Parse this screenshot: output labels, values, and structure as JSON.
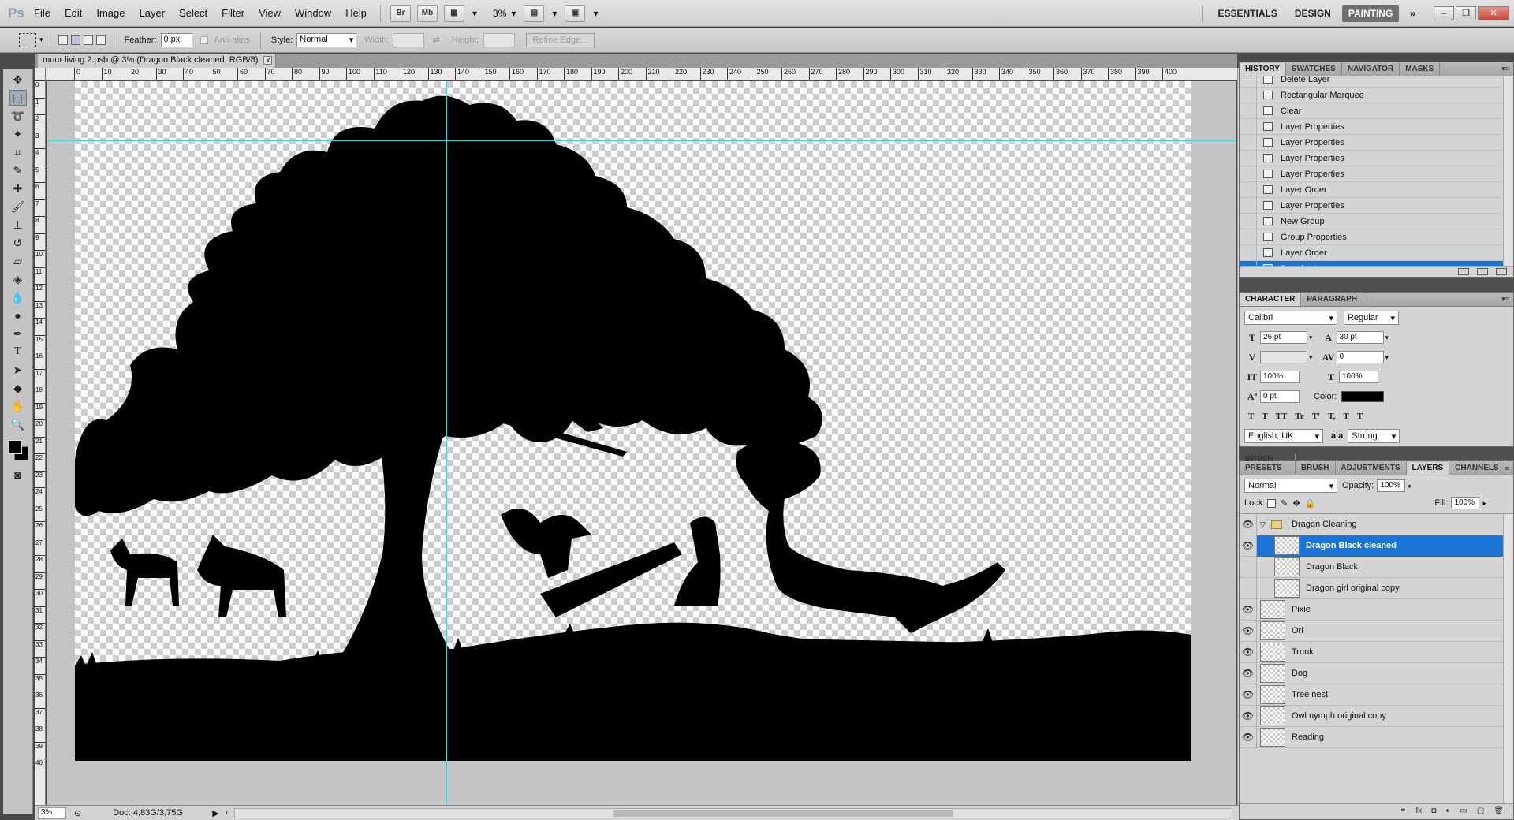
{
  "app": {
    "logo": "Ps"
  },
  "menu": [
    "File",
    "Edit",
    "Image",
    "Layer",
    "Select",
    "Filter",
    "View",
    "Window",
    "Help"
  ],
  "appbar": {
    "bridge_label": "Br",
    "minibridge_label": "Mb",
    "zoom": "3%"
  },
  "workspaces": [
    "ESSENTIALS",
    "DESIGN",
    "PAINTING"
  ],
  "workspace_more": "»",
  "window_controls": {
    "minimize": "–",
    "restore": "❐",
    "close": "✕"
  },
  "options": {
    "feather_label": "Feather:",
    "feather_value": "0 px",
    "antialias_label": "Anti-alias",
    "style_label": "Style:",
    "style_value": "Normal",
    "width_label": "Width:",
    "height_label": "Height:",
    "refine_edge": "Refine Edge..."
  },
  "document": {
    "tab_title": "muur living 2.psb @ 3% (Dragon Black cleaned, RGB/8)",
    "close": "x",
    "ruler_h": [
      "0",
      "10",
      "20",
      "30",
      "40",
      "50",
      "60",
      "70",
      "80",
      "90",
      "100",
      "110",
      "120",
      "130",
      "140",
      "150",
      "160",
      "170",
      "180",
      "190",
      "200",
      "210",
      "220",
      "230",
      "240",
      "250",
      "260",
      "270",
      "280",
      "290",
      "300",
      "310",
      "320",
      "330",
      "340",
      "350",
      "360",
      "370",
      "380",
      "390",
      "400"
    ],
    "ruler_v": [
      "0",
      "1",
      "2",
      "3",
      "4",
      "5",
      "6",
      "7",
      "8",
      "9",
      "10",
      "11",
      "12",
      "13",
      "14",
      "15",
      "16",
      "17",
      "18",
      "19",
      "20",
      "21",
      "22",
      "23",
      "24",
      "25",
      "26",
      "27",
      "28",
      "29",
      "30",
      "31",
      "32",
      "33",
      "34",
      "35",
      "36",
      "37",
      "38",
      "39",
      "40"
    ]
  },
  "status": {
    "zoom": "3%",
    "doc": "Doc: 4,83G/3,75G"
  },
  "history": {
    "tabs": [
      "HISTORY",
      "SWATCHES",
      "NAVIGATOR",
      "MASKS"
    ],
    "items": [
      "Delete Layer",
      "Rectangular Marquee",
      "Clear",
      "Layer Properties",
      "Layer Properties",
      "Layer Properties",
      "Layer Properties",
      "Layer Order",
      "Layer Properties",
      "New Group",
      "Group Properties",
      "Layer Order",
      "Deselect"
    ],
    "active_index": 12
  },
  "character": {
    "tabs": [
      "CHARACTER",
      "PARAGRAPH"
    ],
    "font_family": "Calibri",
    "font_style": "Regular",
    "font_size": "26 pt",
    "leading": "30 pt",
    "kerning": "",
    "tracking": "0",
    "vscale": "100%",
    "hscale": "100%",
    "baseline": "0 pt",
    "color_label": "Color:",
    "color": "#000000",
    "language": "English: UK",
    "aa_label": "a a",
    "antialias": "Strong",
    "style_buttons": [
      "T",
      "T",
      "TT",
      "Tr",
      "T'",
      "T,",
      "T",
      "T"
    ]
  },
  "layers": {
    "tabs": [
      "BRUSH PRESETS",
      "BRUSH",
      "ADJUSTMENTS",
      "LAYERS",
      "CHANNELS"
    ],
    "blend_mode": "Normal",
    "opacity_label": "Opacity:",
    "opacity": "100%",
    "lock_label": "Lock:",
    "fill_label": "Fill:",
    "fill": "100%",
    "items": [
      {
        "name": "Dragon Cleaning",
        "type": "group",
        "visible": true,
        "selected": false,
        "indent": false
      },
      {
        "name": "Dragon Black cleaned",
        "type": "layer",
        "visible": true,
        "selected": true,
        "indent": true
      },
      {
        "name": "Dragon Black",
        "type": "layer",
        "visible": false,
        "selected": false,
        "indent": true
      },
      {
        "name": "Dragon girl original copy",
        "type": "layer",
        "visible": false,
        "selected": false,
        "indent": true
      },
      {
        "name": "Pixie",
        "type": "layer",
        "visible": true,
        "selected": false,
        "indent": false
      },
      {
        "name": "Ori",
        "type": "layer",
        "visible": true,
        "selected": false,
        "indent": false
      },
      {
        "name": "Trunk",
        "type": "layer",
        "visible": true,
        "selected": false,
        "indent": false
      },
      {
        "name": "Dog",
        "type": "layer",
        "visible": true,
        "selected": false,
        "indent": false
      },
      {
        "name": "Tree nest",
        "type": "layer",
        "visible": true,
        "selected": false,
        "indent": false
      },
      {
        "name": "Owl nymph original copy",
        "type": "layer",
        "visible": true,
        "selected": false,
        "indent": false
      },
      {
        "name": "Reading",
        "type": "layer",
        "visible": true,
        "selected": false,
        "indent": false
      }
    ]
  },
  "colors": {
    "selection": "#1a74d6",
    "guide": "#3fd6e0",
    "silhouette": "#000000"
  }
}
